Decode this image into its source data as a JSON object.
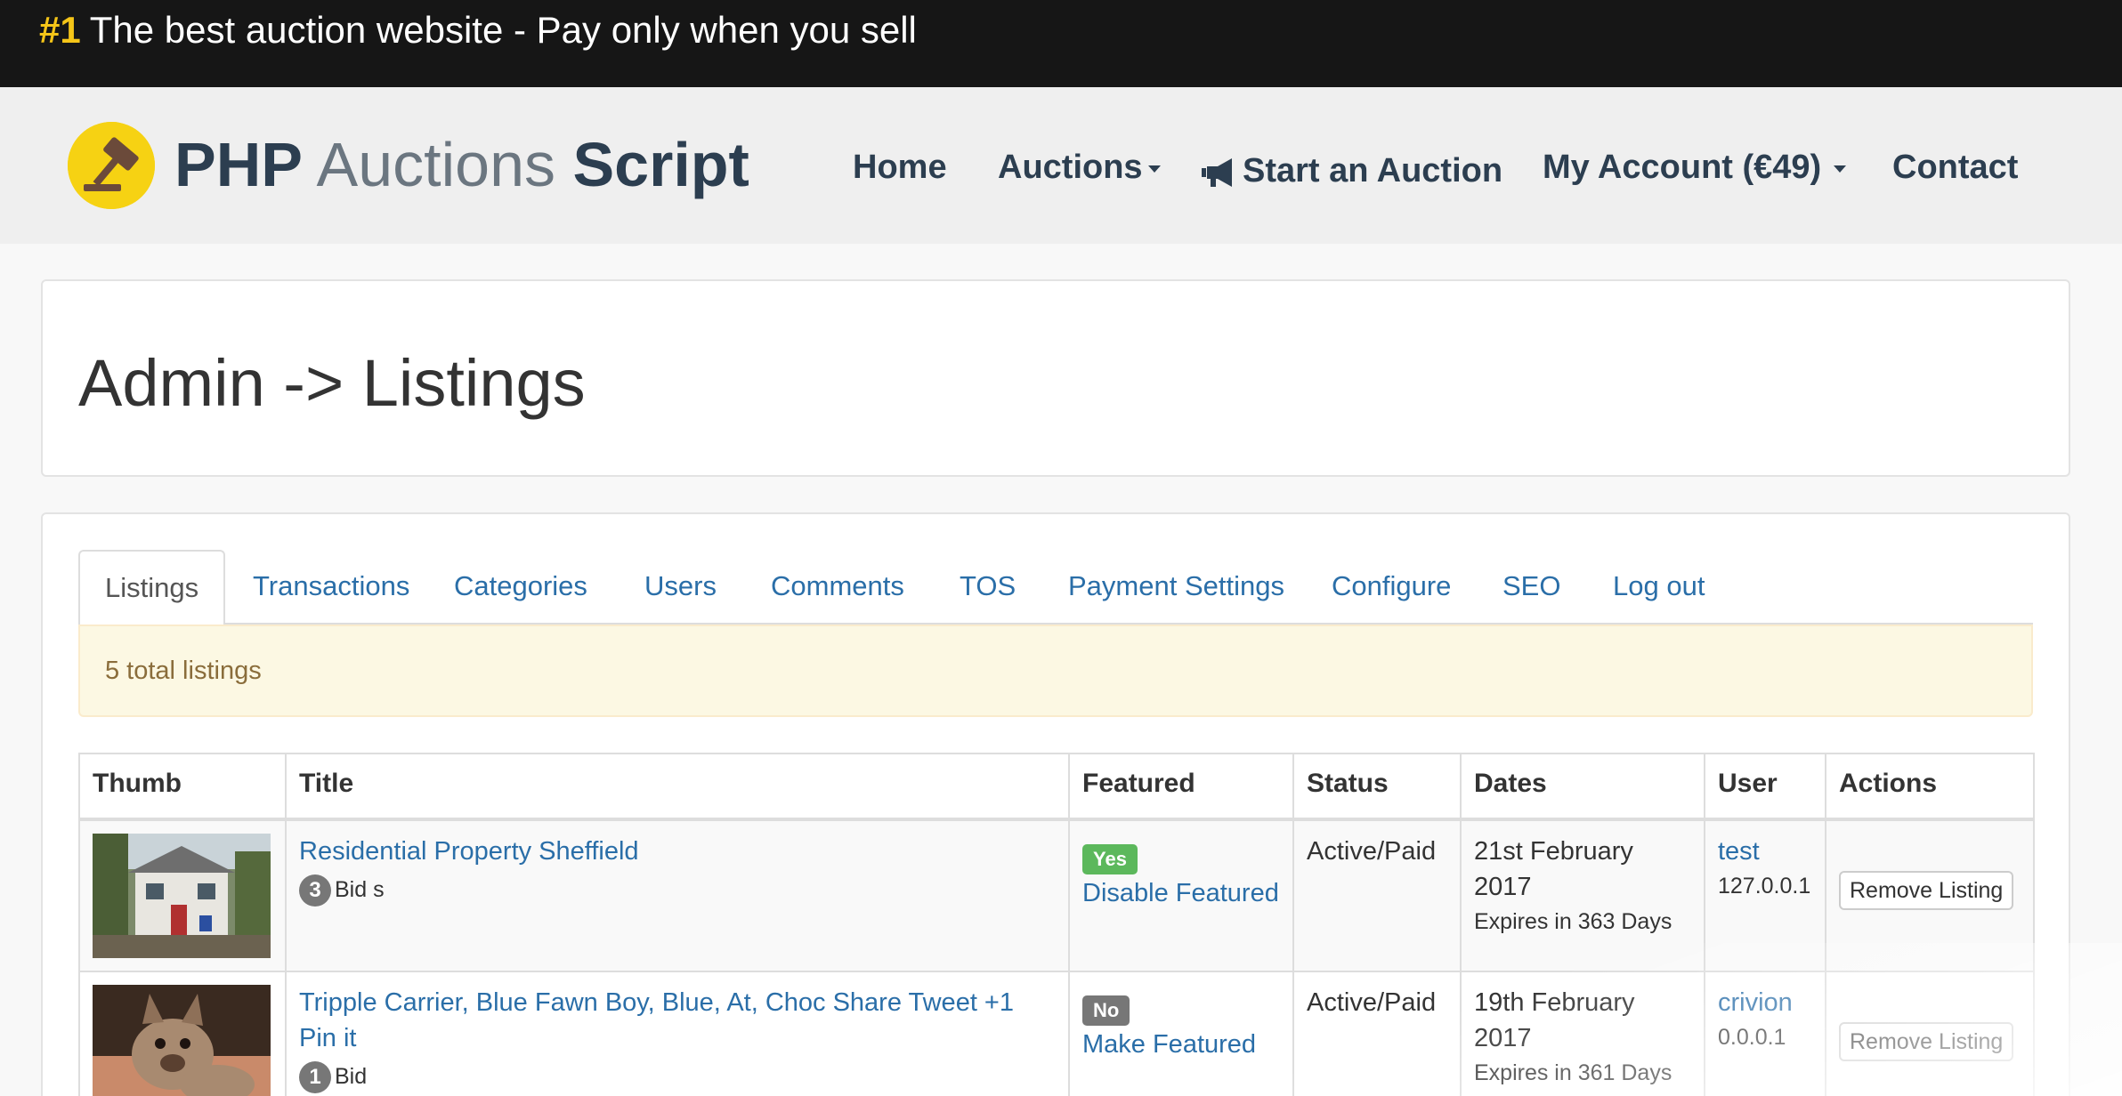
{
  "promo": {
    "number": "#1",
    "text": "The best auction website - Pay only when you sell"
  },
  "brand": {
    "part1": "PHP",
    "part2": "Auctions",
    "part3": "Script",
    "logo_icon": "gavel-icon"
  },
  "nav": {
    "home": "Home",
    "auctions": "Auctions",
    "start": "Start an Auction",
    "account": "My Account (€49)",
    "contact": "Contact"
  },
  "page": {
    "title": "Admin -> Listings"
  },
  "tabs": [
    "Listings",
    "Transactions",
    "Categories",
    "Users",
    "Comments",
    "TOS",
    "Payment Settings",
    "Configure",
    "SEO",
    "Log out"
  ],
  "alert": "5 total listings",
  "table": {
    "headers": [
      "Thumb",
      "Title",
      "Featured",
      "Status",
      "Dates",
      "User",
      "Actions"
    ],
    "rows": [
      {
        "title": "Residential Property Sheffield",
        "bids": "3",
        "bids_label": "Bid s",
        "featured": "Yes",
        "featured_action": "Disable Featured",
        "status": "Active/Paid",
        "date": "21st February 2017",
        "expires": "Expires in 363 Days",
        "user": "test",
        "ip": "127.0.0.1",
        "action": "Remove Listing"
      },
      {
        "title": "Tripple Carrier, Blue Fawn Boy, Blue, At, Choc Share Tweet +1 Pin it",
        "bids": "1",
        "bids_label": "Bid",
        "featured": "No",
        "featured_action": "Make Featured",
        "status": "Active/Paid",
        "date": "19th February 2017",
        "expires": "Expires in 361 Days",
        "user": "crivion",
        "ip": "0.0.0.1",
        "action": "Remove Listing"
      }
    ]
  },
  "colors": {
    "promo_bg": "#161616",
    "accent_yellow": "#f5c518",
    "link": "#2a6ea8",
    "success": "#5cb85c"
  }
}
